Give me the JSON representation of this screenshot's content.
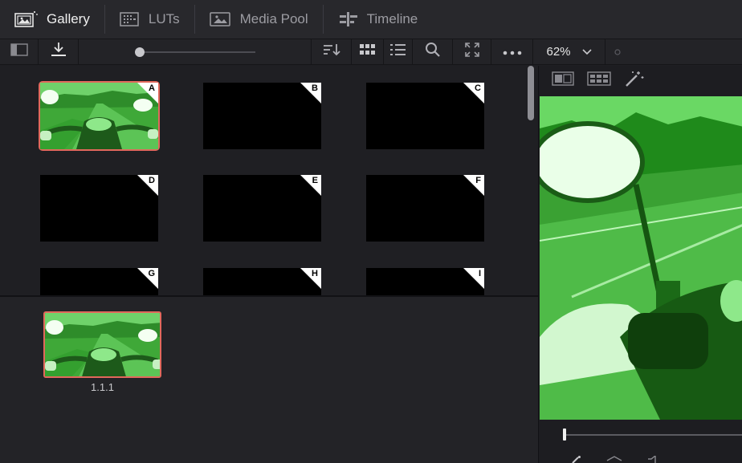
{
  "nav": {
    "tabs": [
      {
        "label": "Gallery",
        "icon": "gallery-icon",
        "active": true
      },
      {
        "label": "LUTs",
        "icon": "luts-icon",
        "active": false
      },
      {
        "label": "Media Pool",
        "icon": "media-pool-icon",
        "active": false
      },
      {
        "label": "Timeline",
        "icon": "timeline-icon",
        "active": false
      }
    ]
  },
  "toolbar": {
    "zoom": "62%",
    "thumb_size_slider": 0.0
  },
  "gallery": {
    "stills": [
      {
        "label": "A",
        "has_image": true,
        "selected": true
      },
      {
        "label": "B",
        "has_image": false
      },
      {
        "label": "C",
        "has_image": false
      },
      {
        "label": "D",
        "has_image": false
      },
      {
        "label": "E",
        "has_image": false
      },
      {
        "label": "F",
        "has_image": false
      },
      {
        "label": "G",
        "has_image": false
      },
      {
        "label": "H",
        "has_image": false
      },
      {
        "label": "I",
        "has_image": false
      }
    ]
  },
  "album": {
    "stills": [
      {
        "label": "1.1.1"
      }
    ]
  },
  "colors": {
    "accent_selection": "#e2685c",
    "background": "#1f1f23"
  }
}
